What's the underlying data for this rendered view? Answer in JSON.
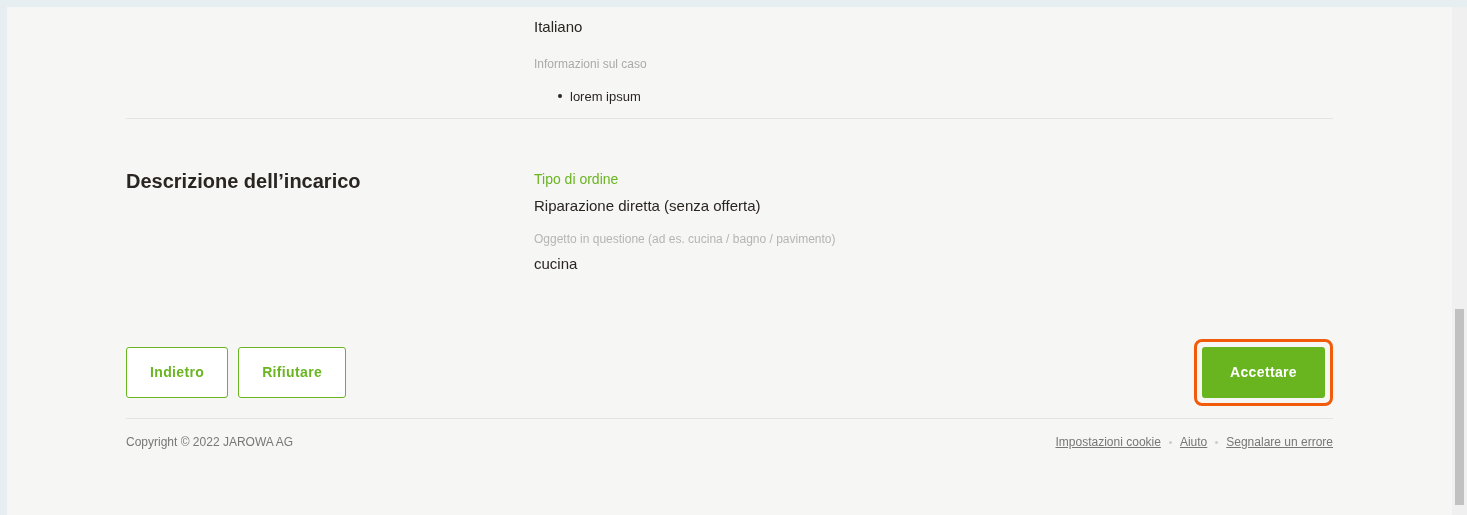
{
  "case_section": {
    "value": "Italiano",
    "info_label": "Informazioni sul caso",
    "info_items": [
      "lorem ipsum"
    ]
  },
  "description_section": {
    "heading": "Descrizione dell’incarico",
    "fields": [
      {
        "label": "Tipo di ordine",
        "value": "Riparazione diretta (senza offerta)",
        "highlighted": true
      },
      {
        "label": "Oggetto in questione (ad es. cucina / bagno / pavimento)",
        "value": "cucina",
        "highlighted": false
      }
    ]
  },
  "actions": {
    "secondary": [
      "Indietro",
      "Rifiutare"
    ],
    "primary": {
      "label": "Accettare",
      "outlined": true
    }
  },
  "footer": {
    "copyright": "Copyright © 2022 JAROWA AG",
    "links": [
      "Impostazioni cookie",
      "Aiuto",
      "Segnalare un errore"
    ]
  }
}
